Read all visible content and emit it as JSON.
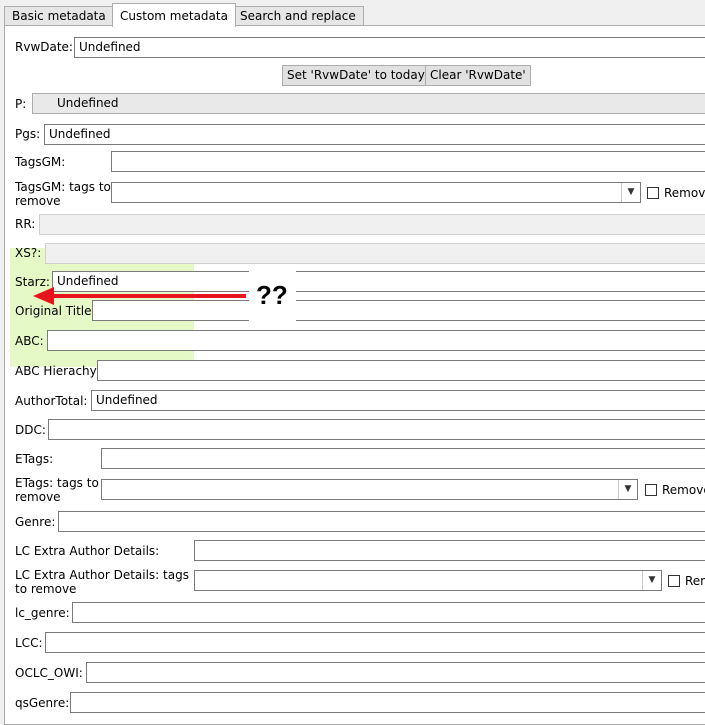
{
  "tabs": [
    {
      "label": "Basic metadata",
      "active": false
    },
    {
      "label": "Custom metadata",
      "active": true
    },
    {
      "label": "Search and replace",
      "active": false
    }
  ],
  "buttons": {
    "set_today": "Set 'RvwDate' to today",
    "clear": "Clear 'RvwDate'"
  },
  "fields": {
    "rvwdate": {
      "label": "RvwDate:",
      "value": "Undefined"
    },
    "p": {
      "label": "P:",
      "value": "Undefined"
    },
    "pgs": {
      "label": "Pgs:",
      "value": "Undefined"
    },
    "tagsgm": {
      "label": "TagsGM:",
      "value": ""
    },
    "tagsgm_remove": {
      "label": "TagsGM: tags to remove",
      "value": "",
      "checkbox": "Remove"
    },
    "rr": {
      "label": "RR:",
      "value": ""
    },
    "xs": {
      "label": "XS?:",
      "value": ""
    },
    "starz": {
      "label": "Starz:",
      "value": "Undefined"
    },
    "original_title": {
      "label": "Original Title:",
      "value": ""
    },
    "abc": {
      "label": "ABC:",
      "value": ""
    },
    "abc_hierachy": {
      "label": "ABC Hierachy:",
      "value": ""
    },
    "authortotal": {
      "label": "AuthorTotal:",
      "value": "Undefined"
    },
    "ddc": {
      "label": "DDC:",
      "value": ""
    },
    "etags": {
      "label": "ETags:",
      "value": ""
    },
    "etags_remove": {
      "label": "ETags: tags to remove",
      "value": "",
      "checkbox": "Remove"
    },
    "genre": {
      "label": "Genre:",
      "value": ""
    },
    "lc_extra": {
      "label": "LC Extra Author Details:",
      "value": ""
    },
    "lc_extra_remove": {
      "label": "LC Extra Author Details: tags to remove",
      "value": "",
      "checkbox": "Rem"
    },
    "lc_genre": {
      "label": "lc_genre:",
      "value": ""
    },
    "lcc": {
      "label": "LCC:",
      "value": ""
    },
    "oclc_owi": {
      "label": "OCLC_OWI:",
      "value": ""
    },
    "qsgenre": {
      "label": "qsGenre:",
      "value": ""
    }
  },
  "annotation": {
    "text": "??",
    "arrow_color": "#e8141b",
    "highlight_color": "#e5f9c6"
  }
}
